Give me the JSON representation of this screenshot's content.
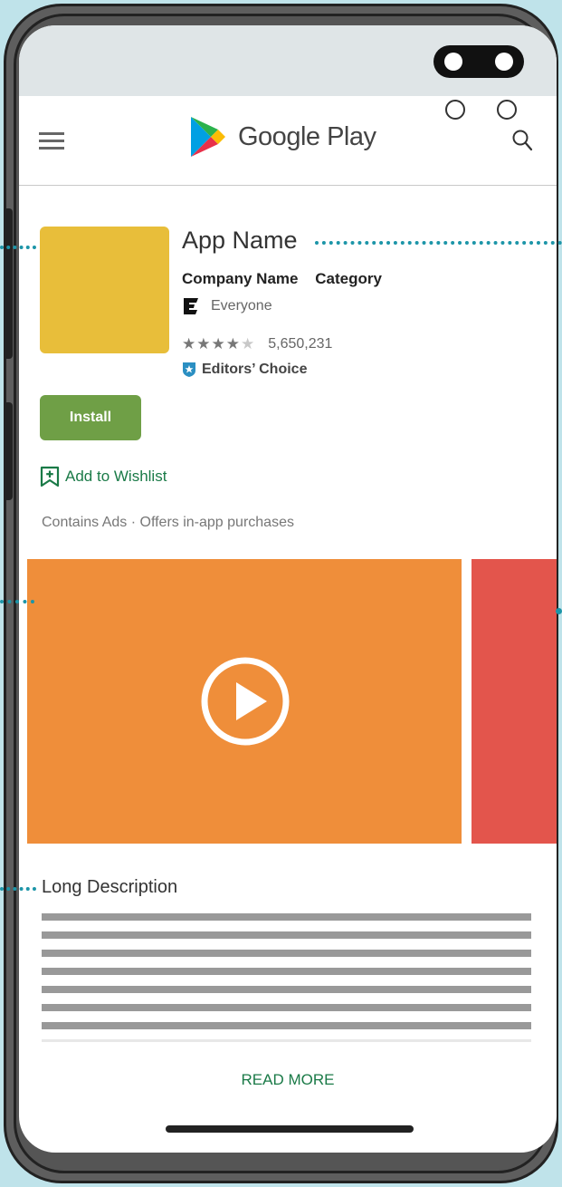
{
  "toolbar": {
    "brand": "Google Play",
    "menu_icon": "hamburger-menu-icon",
    "search_icon": "search-icon"
  },
  "app": {
    "name": "App Name",
    "company": "Company Name",
    "category": "Category",
    "content_rating": "Everyone",
    "rating_stars": 4,
    "rating_count": "5,650,231",
    "badge": "Editors’ Choice",
    "install_label": "Install",
    "wishlist_label": "Add to Wishlist",
    "purchase_note": "Contains Ads · Offers in-app purchases"
  },
  "media": {
    "video_color": "#ef8e3a",
    "screenshot_color": "#e3554c",
    "icon_color": "#e8be3a"
  },
  "description": {
    "title": "Long Description",
    "read_more_label": "READ MORE"
  },
  "colors": {
    "accent_green": "#1a7a47",
    "install_green": "#6f9f46",
    "annotation": "#1c95a8"
  }
}
